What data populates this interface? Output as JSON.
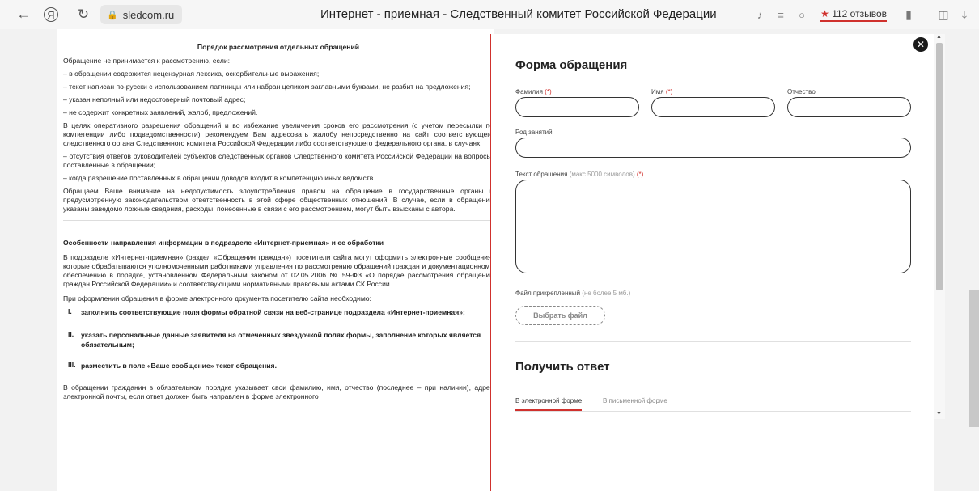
{
  "browser": {
    "domain": "sledcom.ru",
    "page_title": "Интернет - приемная - Следственный комитет Российской Федерации",
    "reviews_label": "112 отзывов",
    "icons": [
      "back-arrow-icon",
      "yandex-logo-icon",
      "reload-icon",
      "lock-icon",
      "headphones-icon",
      "reader-icon",
      "chat-icon",
      "star-icon",
      "bookmark-icon",
      "extensions-icon",
      "download-icon"
    ]
  },
  "article": {
    "section1_title": "Порядок рассмотрения отдельных обращений",
    "section1_paragraphs": [
      "Обращение не принимается к рассмотрению, если:",
      "– в обращении содержится нецензурная лексика, оскорбительные выражения;",
      "– текст написан по-русски с использованием латиницы или набран целиком заглавными буквами, не разбит на предложения;",
      "– указан неполный или недостоверный почтовый адрес;",
      "– не содержит конкретных заявлений, жалоб, предложений.",
      "В целях оперативного разрешения обращений и во избежание увеличения сроков его рассмотрения (с учетом пересылки по компетенции либо подведомственности) рекомендуем Вам адресовать жалобу непосредственно на сайт соответствующего следственного органа Следственного комитета Российской Федерации либо соответствующего федерального органа, в случаях:",
      "– отсутствия ответов руководителей субъектов следственных органов Следственного комитета Российской Федерации на вопросы, поставленные в обращении;",
      "– когда разрешение поставленных в обращении доводов входит в компетенцию иных ведомств.",
      "Обращаем Ваше внимание на недопустимость злоупотребления правом на обращение в государственные органы и предусмотренную законодательством ответственность в этой сфере общественных отношений. В случае, если в обращении указаны заведомо ложные сведения, расходы, понесенные в связи с его рассмотрением, могут быть взысканы с автора."
    ],
    "section2_title": "Особенности направления информации в подразделе «Интернет-приемная» и ее обработки",
    "section2_paragraphs": [
      " В подразделе «Интернет-приемная» (раздел «Обращения граждан») посетители сайта могут оформить электронные сообщения, которые обрабатываются уполномоченными работниками управления по рассмотрению обращений граждан и документационному обеспечению в порядке, установленном Федеральным законом от 02.05.2006 № 59-ФЗ «О порядке рассмотрения обращений граждан Российской Федерации» и соответствующими нормативными правовыми актами СК России.",
      " При оформлении обращения в форме электронного документа посетителю сайта необходимо:"
    ],
    "steps": [
      {
        "num": "I.",
        "text": "заполнить соответствующие поля формы обратной связи на веб-странице подраздела «Интернет-приемная»;"
      },
      {
        "num": "II.",
        "text": "указать персональные данные заявителя на отмеченных звездочкой полях формы, заполнение которых является обязательным;"
      },
      {
        "num": "III.",
        "text": "разместить в поле «Ваше сообщение» текст обращения."
      }
    ],
    "closing_paragraph": "В обращении гражданин в обязательном порядке указывает свои фамилию, имя, отчество (последнее – при наличии), адрес электронной почты, если ответ должен быть направлен в форме электронного"
  },
  "form": {
    "title": "Форма обращения",
    "surname_label": "Фамилия",
    "name_label": "Имя",
    "patronymic_label": "Отчество",
    "occupation_label": "Род занятий",
    "message_label": "Текст обращения",
    "message_hint": "(макс 5000 символов)",
    "required_mark": "(*)",
    "file_label": "Файл прикрепленный",
    "file_hint": "(не более 5 мб.)",
    "file_button": "Выбрать файл",
    "answer_title": "Получить ответ",
    "tab_electronic": "В электронной форме",
    "tab_paper": "В письменной форме",
    "surname_value": "",
    "name_value": "",
    "patronymic_value": "",
    "occupation_value": "",
    "message_value": ""
  },
  "colors": {
    "accent": "#d0312d",
    "text": "#222222",
    "border": "#333333"
  }
}
